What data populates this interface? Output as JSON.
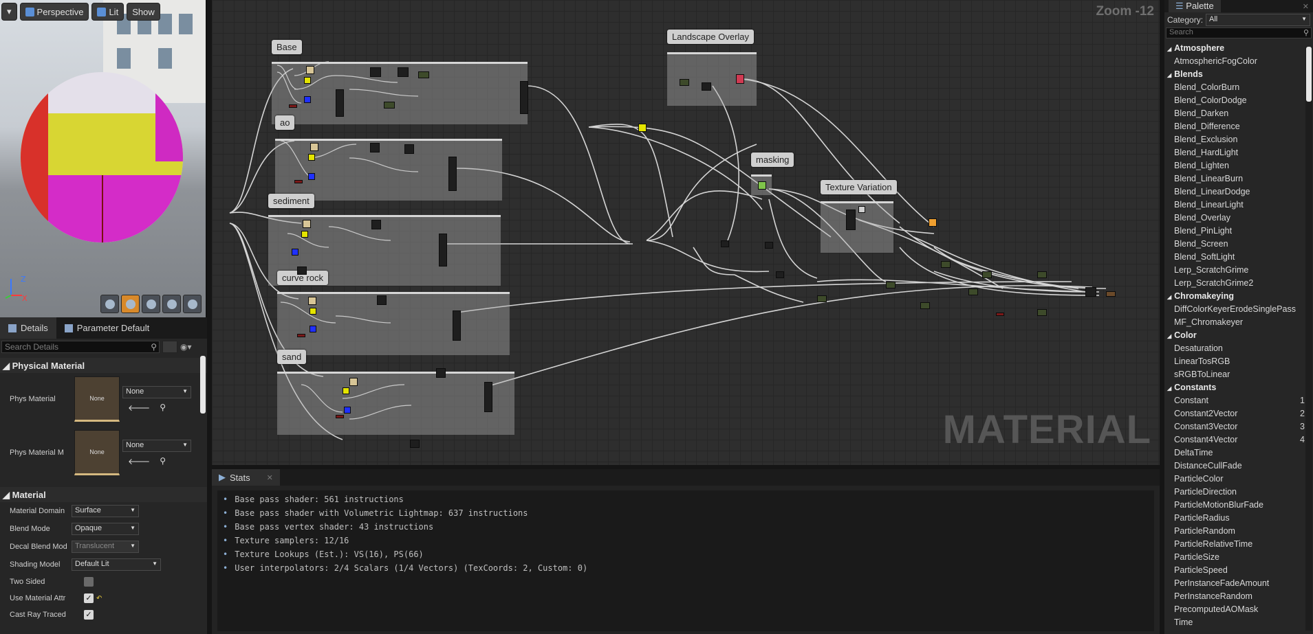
{
  "viewport": {
    "perspective_label": "Perspective",
    "lit_label": "Lit",
    "show_label": "Show",
    "axis_z": "Z",
    "axis_x": "X"
  },
  "details": {
    "tabs": [
      "Details",
      "Parameter Default"
    ],
    "search_placeholder": "Search Details",
    "physical_material": {
      "heading": "Physical Material",
      "phys_material_label": "Phys Material",
      "phys_material_thumb": "None",
      "phys_material_value": "None",
      "phys_material_m_label": "Phys Material M",
      "phys_material_m_thumb": "None",
      "phys_material_m_value": "None"
    },
    "material": {
      "heading": "Material",
      "domain_label": "Material Domain",
      "domain_value": "Surface",
      "blend_mode_label": "Blend Mode",
      "blend_mode_value": "Opaque",
      "decal_blend_label": "Decal Blend Mod",
      "decal_blend_value": "Translucent",
      "shading_label": "Shading Model",
      "shading_value": "Default Lit",
      "two_sided_label": "Two Sided",
      "two_sided_checked": false,
      "use_attr_label": "Use Material Attr",
      "use_attr_checked": true,
      "cast_ray_label": "Cast Ray Traced",
      "cast_ray_checked": true
    }
  },
  "graph": {
    "zoom_label": "Zoom -12",
    "watermark": "MATERIAL",
    "comments": [
      "Base",
      "ao",
      "sediment",
      "curve rock",
      "sand",
      "Landscape Overlay",
      "masking",
      "Texture Variation"
    ]
  },
  "stats": {
    "tab_label": "Stats",
    "close_label": "✕",
    "lines": [
      "Base pass shader: 561 instructions",
      "Base pass shader with Volumetric Lightmap: 637 instructions",
      "Base pass vertex shader: 43 instructions",
      "Texture samplers: 12/16",
      "Texture Lookups (Est.): VS(16), PS(66)",
      "User interpolators: 2/4 Scalars (1/4 Vectors) (TexCoords: 2, Custom: 0)"
    ]
  },
  "palette": {
    "title": "Palette",
    "category_label": "Category:",
    "category_value": "All",
    "search_placeholder": "Search",
    "items": [
      {
        "label": "Atmosphere",
        "header": true,
        "shortcut": ""
      },
      {
        "label": "AtmosphericFogColor",
        "header": false,
        "shortcut": ""
      },
      {
        "label": "Blends",
        "header": true,
        "shortcut": ""
      },
      {
        "label": "Blend_ColorBurn",
        "header": false,
        "shortcut": ""
      },
      {
        "label": "Blend_ColorDodge",
        "header": false,
        "shortcut": ""
      },
      {
        "label": "Blend_Darken",
        "header": false,
        "shortcut": ""
      },
      {
        "label": "Blend_Difference",
        "header": false,
        "shortcut": ""
      },
      {
        "label": "Blend_Exclusion",
        "header": false,
        "shortcut": ""
      },
      {
        "label": "Blend_HardLight",
        "header": false,
        "shortcut": ""
      },
      {
        "label": "Blend_Lighten",
        "header": false,
        "shortcut": ""
      },
      {
        "label": "Blend_LinearBurn",
        "header": false,
        "shortcut": ""
      },
      {
        "label": "Blend_LinearDodge",
        "header": false,
        "shortcut": ""
      },
      {
        "label": "Blend_LinearLight",
        "header": false,
        "shortcut": ""
      },
      {
        "label": "Blend_Overlay",
        "header": false,
        "shortcut": ""
      },
      {
        "label": "Blend_PinLight",
        "header": false,
        "shortcut": ""
      },
      {
        "label": "Blend_Screen",
        "header": false,
        "shortcut": ""
      },
      {
        "label": "Blend_SoftLight",
        "header": false,
        "shortcut": ""
      },
      {
        "label": "Lerp_ScratchGrime",
        "header": false,
        "shortcut": ""
      },
      {
        "label": "Lerp_ScratchGrime2",
        "header": false,
        "shortcut": ""
      },
      {
        "label": "Chromakeying",
        "header": true,
        "shortcut": ""
      },
      {
        "label": "DiffColorKeyerErodeSinglePass",
        "header": false,
        "shortcut": ""
      },
      {
        "label": "MF_Chromakeyer",
        "header": false,
        "shortcut": ""
      },
      {
        "label": "Color",
        "header": true,
        "shortcut": ""
      },
      {
        "label": "Desaturation",
        "header": false,
        "shortcut": ""
      },
      {
        "label": "LinearTosRGB",
        "header": false,
        "shortcut": ""
      },
      {
        "label": "sRGBToLinear",
        "header": false,
        "shortcut": ""
      },
      {
        "label": "Constants",
        "header": true,
        "shortcut": ""
      },
      {
        "label": "Constant",
        "header": false,
        "shortcut": "1"
      },
      {
        "label": "Constant2Vector",
        "header": false,
        "shortcut": "2"
      },
      {
        "label": "Constant3Vector",
        "header": false,
        "shortcut": "3"
      },
      {
        "label": "Constant4Vector",
        "header": false,
        "shortcut": "4"
      },
      {
        "label": "DeltaTime",
        "header": false,
        "shortcut": ""
      },
      {
        "label": "DistanceCullFade",
        "header": false,
        "shortcut": ""
      },
      {
        "label": "ParticleColor",
        "header": false,
        "shortcut": ""
      },
      {
        "label": "ParticleDirection",
        "header": false,
        "shortcut": ""
      },
      {
        "label": "ParticleMotionBlurFade",
        "header": false,
        "shortcut": ""
      },
      {
        "label": "ParticleRadius",
        "header": false,
        "shortcut": ""
      },
      {
        "label": "ParticleRandom",
        "header": false,
        "shortcut": ""
      },
      {
        "label": "ParticleRelativeTime",
        "header": false,
        "shortcut": ""
      },
      {
        "label": "ParticleSize",
        "header": false,
        "shortcut": ""
      },
      {
        "label": "ParticleSpeed",
        "header": false,
        "shortcut": ""
      },
      {
        "label": "PerInstanceFadeAmount",
        "header": false,
        "shortcut": ""
      },
      {
        "label": "PerInstanceRandom",
        "header": false,
        "shortcut": ""
      },
      {
        "label": "PrecomputedAOMask",
        "header": false,
        "shortcut": ""
      },
      {
        "label": "Time",
        "header": false,
        "shortcut": ""
      }
    ]
  }
}
